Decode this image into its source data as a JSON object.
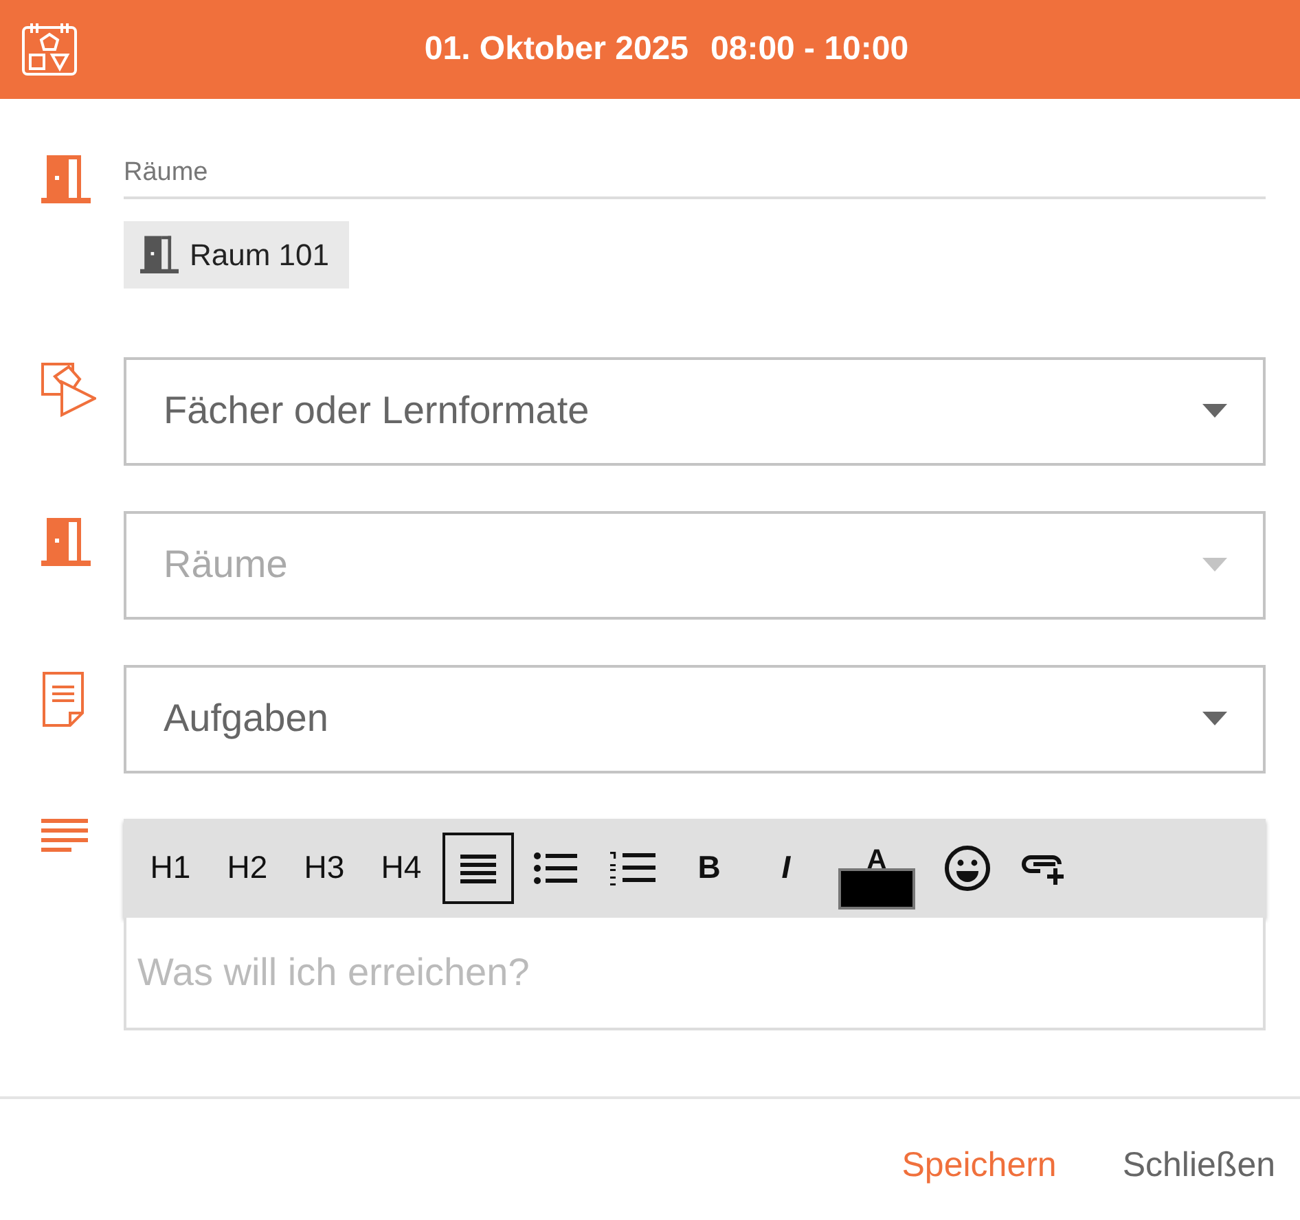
{
  "header": {
    "date": "01. Oktober 2025",
    "time": "08:00 - 10:00"
  },
  "rooms": {
    "label": "Räume",
    "chips": [
      {
        "label": "Raum 101"
      }
    ]
  },
  "selects": [
    {
      "kind": "subject",
      "value": "Fächer oder Lernformate",
      "disabled": false
    },
    {
      "kind": "room",
      "placeholder": "Räume",
      "disabled": true
    },
    {
      "kind": "task",
      "value": "Aufgaben",
      "disabled": false
    }
  ],
  "editor": {
    "toolbar": [
      {
        "kind": "text",
        "label": "H1",
        "selected": false
      },
      {
        "kind": "text",
        "label": "H2",
        "selected": false
      },
      {
        "kind": "text",
        "label": "H3",
        "selected": false
      },
      {
        "kind": "text",
        "label": "H4",
        "selected": false
      },
      {
        "kind": "align",
        "selected": true
      },
      {
        "kind": "bullets",
        "selected": false
      },
      {
        "kind": "numbers",
        "selected": false
      },
      {
        "kind": "bold",
        "label": "B",
        "selected": false
      },
      {
        "kind": "italic",
        "label": "I",
        "selected": false
      },
      {
        "kind": "color",
        "label": "A",
        "color": "#000000",
        "selected": false
      },
      {
        "kind": "emoji",
        "selected": false
      },
      {
        "kind": "link",
        "selected": false
      }
    ],
    "placeholder": "Was will ich erreichen?"
  },
  "buttons": [
    {
      "label": "Speichern",
      "kind": "primary"
    },
    {
      "label": "Schließen",
      "kind": "secondary"
    }
  ]
}
